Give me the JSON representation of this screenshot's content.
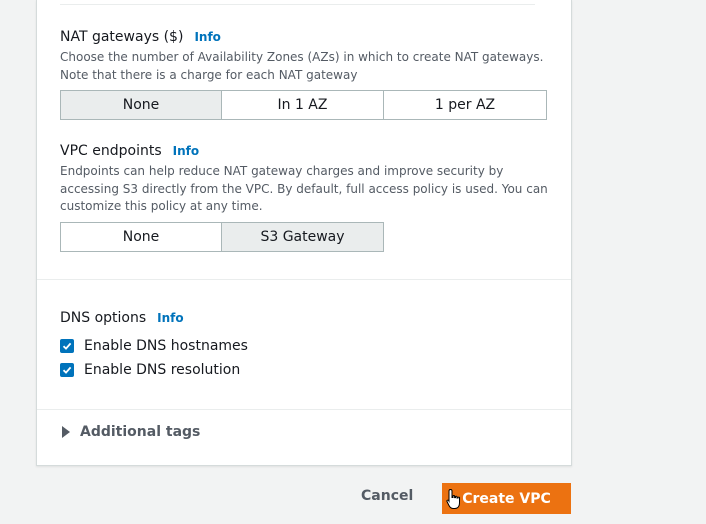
{
  "nat": {
    "title": "NAT gateways ($)",
    "info": "Info",
    "desc_line1": "Choose the number of Availability Zones (AZs) in which to create NAT gateways.",
    "desc_line2": "Note that there is a charge for each NAT gateway",
    "options": [
      "None",
      "In 1 AZ",
      "1 per AZ"
    ],
    "selected": "None"
  },
  "vpce": {
    "title": "VPC endpoints",
    "info": "Info",
    "desc_line1": "Endpoints can help reduce NAT gateway charges and improve security by",
    "desc_line2": "accessing S3 directly from the VPC. By default, full access policy is used. You can",
    "desc_line3": "customize this policy at any time.",
    "options": [
      "None",
      "S3 Gateway"
    ],
    "selected": "S3 Gateway"
  },
  "dns": {
    "title": "DNS options",
    "info": "Info",
    "hostnames_label": "Enable DNS hostnames",
    "resolution_label": "Enable DNS resolution",
    "hostnames_checked": true,
    "resolution_checked": true
  },
  "tags": {
    "label": "Additional tags"
  },
  "footer": {
    "cancel_label": "Cancel",
    "create_label": "Create VPC"
  },
  "colors": {
    "accent": "#0073bb",
    "primary": "#ec7211",
    "selected_bg": "#eaeded"
  }
}
